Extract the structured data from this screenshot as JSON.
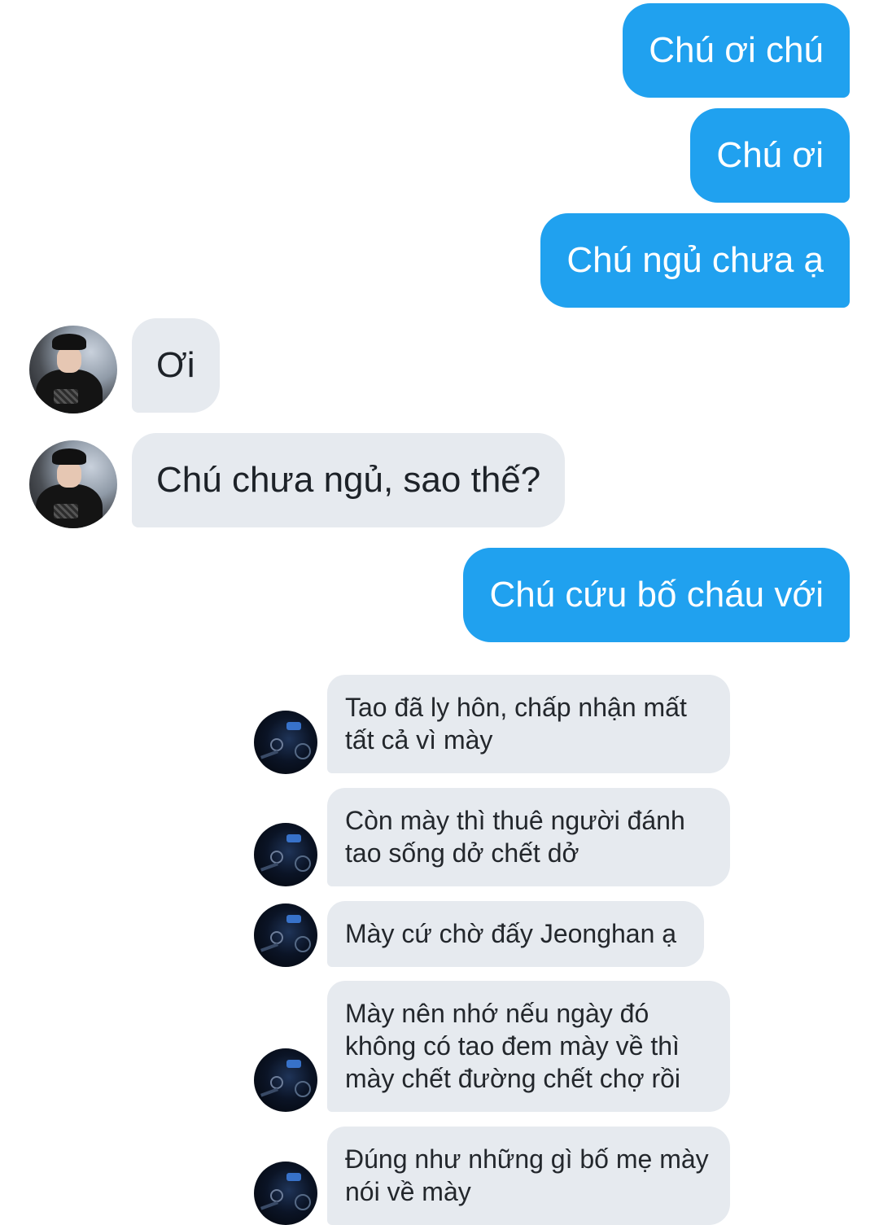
{
  "conversation": {
    "sent": [
      "Chú ơi chú",
      "Chú ơi",
      "Chú ngủ chưa ạ",
      "Chú cứu bố cháu với"
    ],
    "received_a": [
      "Ơi",
      "Chú chưa ngủ, sao thế?"
    ],
    "received_b": [
      "Tao đã ly hôn, chấp nhận mất tất cả vì mày",
      "Còn mày thì thuê người đánh tao sống dở chết dở",
      "Mày cứ chờ đấy Jeonghan ạ",
      "Mày nên nhớ nếu ngày đó không có tao đem mày về thì mày chết đường chết chợ rồi",
      "Đúng như những gì bố mẹ mày nói về mày"
    ]
  },
  "colors": {
    "sent_bubble": "#20a1ef",
    "received_bubble": "#e6eaef",
    "background": "#ffffff"
  }
}
